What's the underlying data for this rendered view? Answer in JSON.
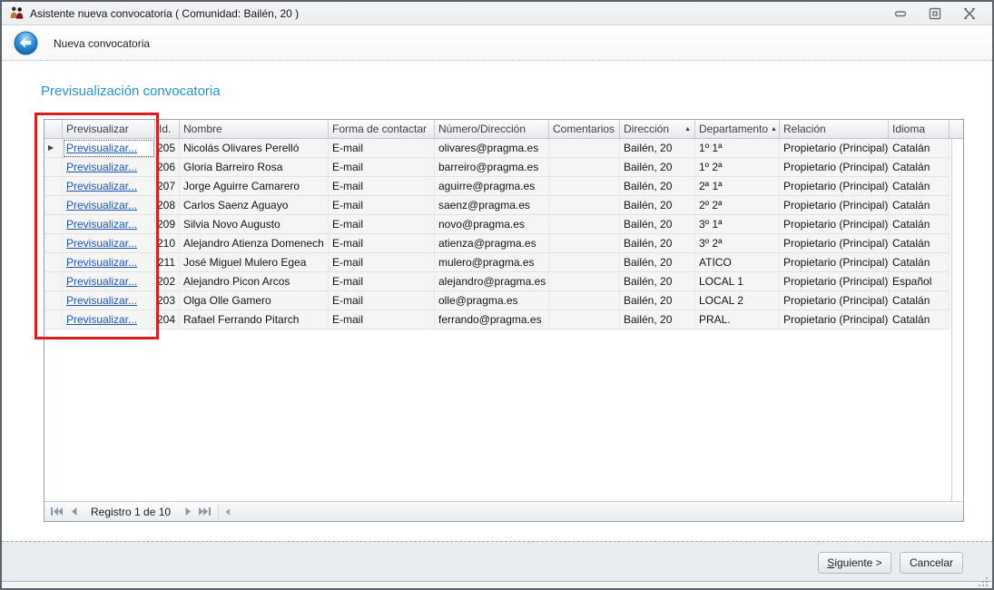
{
  "window": {
    "title": "Asistente nueva convocatoria ( Comunidad: Bailén, 20 )"
  },
  "wizard": {
    "header_title": "Nueva convocatoria",
    "page_title": "Previsualización convocatoria"
  },
  "table": {
    "preview_label": "Previsualizar...",
    "columns": [
      {
        "label": ""
      },
      {
        "label": "Previsualizar"
      },
      {
        "label": "Id."
      },
      {
        "label": "Nombre"
      },
      {
        "label": "Forma de contactar"
      },
      {
        "label": "Número/Dirección"
      },
      {
        "label": "Comentarios"
      },
      {
        "label": "Dirección",
        "sorted": "asc"
      },
      {
        "label": "Departamento",
        "sorted": "asc"
      },
      {
        "label": "Relación"
      },
      {
        "label": "Idioma"
      }
    ],
    "rows": [
      {
        "id": "205",
        "nombre": "Nicolás Olivares Perelló",
        "forma": "E-mail",
        "numero": "olivares@pragma.es",
        "comentarios": "",
        "direccion": "Bailén, 20",
        "departamento": "1º 1ª",
        "relacion": "Propietario (Principal)",
        "idioma": "Catalán"
      },
      {
        "id": "206",
        "nombre": "Gloria Barreiro Rosa",
        "forma": "E-mail",
        "numero": "barreiro@pragma.es",
        "comentarios": "",
        "direccion": "Bailén, 20",
        "departamento": "1º 2ª",
        "relacion": "Propietario (Principal)",
        "idioma": "Catalán"
      },
      {
        "id": "207",
        "nombre": "Jorge Aguirre Camarero",
        "forma": "E-mail",
        "numero": "aguirre@pragma.es",
        "comentarios": "",
        "direccion": "Bailén, 20",
        "departamento": "2ª 1ª",
        "relacion": "Propietario (Principal)",
        "idioma": "Catalán"
      },
      {
        "id": "208",
        "nombre": "Carlos Saenz Aguayo",
        "forma": "E-mail",
        "numero": "saenz@pragma.es",
        "comentarios": "",
        "direccion": "Bailén, 20",
        "departamento": "2º 2ª",
        "relacion": "Propietario (Principal)",
        "idioma": "Catalán"
      },
      {
        "id": "209",
        "nombre": "Silvia Novo Augusto",
        "forma": "E-mail",
        "numero": "novo@pragma.es",
        "comentarios": "",
        "direccion": "Bailén, 20",
        "departamento": "3º 1ª",
        "relacion": "Propietario (Principal)",
        "idioma": "Catalán"
      },
      {
        "id": "210",
        "nombre": "Alejandro Atienza Domenech",
        "forma": "E-mail",
        "numero": "atienza@pragma.es",
        "comentarios": "",
        "direccion": "Bailén, 20",
        "departamento": "3º 2ª",
        "relacion": "Propietario (Principal)",
        "idioma": "Catalán"
      },
      {
        "id": "211",
        "nombre": "José Miguel Mulero Egea",
        "forma": "E-mail",
        "numero": "mulero@pragma.es",
        "comentarios": "",
        "direccion": "Bailén, 20",
        "departamento": "ATICO",
        "relacion": "Propietario (Principal)",
        "idioma": "Catalán"
      },
      {
        "id": "202",
        "nombre": "Alejandro Picon Arcos",
        "forma": "E-mail",
        "numero": "alejandro@pragma.es",
        "comentarios": "",
        "direccion": "Bailén, 20",
        "departamento": "LOCAL 1",
        "relacion": "Propietario (Principal)",
        "idioma": "Español"
      },
      {
        "id": "203",
        "nombre": "Olga Olle Gamero",
        "forma": "E-mail",
        "numero": "olle@pragma.es",
        "comentarios": "",
        "direccion": "Bailén, 20",
        "departamento": "LOCAL 2",
        "relacion": "Propietario (Principal)",
        "idioma": "Catalán"
      },
      {
        "id": "204",
        "nombre": "Rafael Ferrando Pitarch",
        "forma": "E-mail",
        "numero": "ferrando@pragma.es",
        "comentarios": "",
        "direccion": "Bailén, 20",
        "departamento": "PRAL.",
        "relacion": "Propietario (Principal)",
        "idioma": "Catalán"
      }
    ]
  },
  "navigator": {
    "label": "Registro 1 de 10"
  },
  "footer": {
    "next_mnemonic": "S",
    "next_rest": "iguiente >",
    "cancel_label": "Cancelar"
  },
  "annotation": {
    "color": "#e01b1b"
  }
}
